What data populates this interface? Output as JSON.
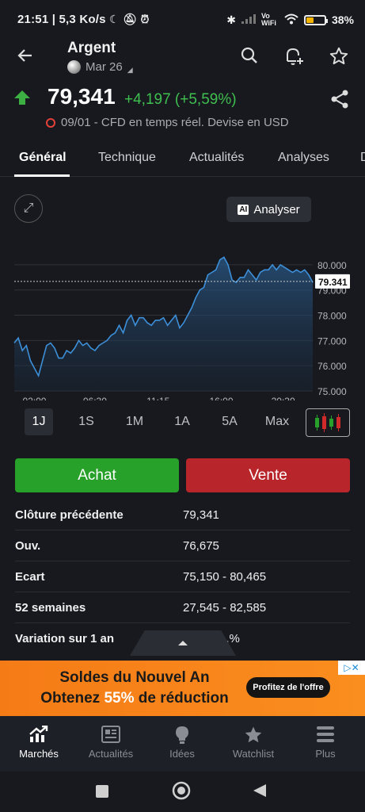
{
  "status_bar": {
    "time_speed": "21:51 | 5,3 Ko/s",
    "vowifi": "Vo WiFi",
    "battery": "38%",
    "battery_level": 0.38
  },
  "header": {
    "title": "Argent",
    "contract": "Mar 26"
  },
  "quote": {
    "price": "79,341",
    "change": "+4,197 (+5,59%)",
    "direction": "up",
    "info": "09/01 - CFD en temps réel. Devise en USD"
  },
  "tabs": [
    "Général",
    "Technique",
    "Actualités",
    "Analyses",
    "D"
  ],
  "chart": {
    "analyser_label": "Analyser",
    "ai_badge": "AI",
    "current_label": "79.341"
  },
  "chart_data": {
    "type": "area",
    "x_ticks": [
      "02:00",
      "06:30",
      "11:15",
      "16:00",
      "20:30"
    ],
    "y_ticks": [
      "80.000",
      "79.000",
      "78.000",
      "77.000",
      "76.000",
      "75.000"
    ],
    "ylim": [
      75.0,
      80.5
    ],
    "current_value": 79.341,
    "x": [
      0,
      0.3,
      0.6,
      0.9,
      1.2,
      1.5,
      1.8,
      2.1,
      2.4,
      2.7,
      3.0,
      3.3,
      3.6,
      3.9,
      4.2,
      4.5,
      4.8,
      5.1,
      5.4,
      5.7,
      6.0,
      6.3,
      6.6,
      6.9,
      7.2,
      7.5,
      7.8,
      8.1,
      8.4,
      8.7,
      9.0,
      9.3,
      9.6,
      9.9,
      10.2,
      10.5,
      10.8,
      11.1,
      11.4,
      11.7,
      12.0,
      12.3,
      12.6,
      12.9,
      13.2,
      13.5,
      13.8,
      14.1,
      14.4,
      14.7,
      15.0,
      15.3,
      15.6,
      15.9,
      16.2,
      16.5,
      16.8,
      17.1,
      17.4,
      17.7,
      18.0,
      18.3,
      18.6,
      18.9,
      19.2,
      19.5,
      19.8,
      20.1,
      20.4,
      20.7,
      21.0,
      21.3,
      21.6,
      21.9,
      22.2
    ],
    "values": [
      76.9,
      77.1,
      76.6,
      76.8,
      76.2,
      75.9,
      75.6,
      76.2,
      76.8,
      76.9,
      76.7,
      76.3,
      76.3,
      76.6,
      76.5,
      76.7,
      77.0,
      76.8,
      76.9,
      76.7,
      76.6,
      76.8,
      76.9,
      77.0,
      77.2,
      77.3,
      77.6,
      77.3,
      77.8,
      78.0,
      77.6,
      77.9,
      77.9,
      77.7,
      77.6,
      77.8,
      77.8,
      77.9,
      77.6,
      77.8,
      78.0,
      77.5,
      77.7,
      78.0,
      78.3,
      78.7,
      79.0,
      79.1,
      79.6,
      79.7,
      79.8,
      80.2,
      80.3,
      80.0,
      79.4,
      79.3,
      79.5,
      79.5,
      79.8,
      79.6,
      79.4,
      79.7,
      79.8,
      79.8,
      80.0,
      79.8,
      80.0,
      79.9,
      79.8,
      79.7,
      79.8,
      79.7,
      79.8,
      79.6,
      79.3
    ],
    "xlim": [
      0,
      22.2
    ],
    "x_tick_positions": [
      1.5,
      6.0,
      10.7,
      15.4,
      20.0
    ],
    "color": "#3c8fd8",
    "grid": true
  },
  "timeframes": {
    "items": [
      "1J",
      "1S",
      "1M",
      "1A",
      "5A",
      "Max"
    ],
    "active": "1J"
  },
  "trade": {
    "buy": "Achat",
    "sell": "Vente",
    "buy_color": "#27a12a",
    "sell_color": "#b8252a"
  },
  "stats": [
    {
      "label": "Clôture précédente",
      "value": "79,341"
    },
    {
      "label": "Ouv.",
      "value": "76,675"
    },
    {
      "label": "Ecart",
      "value": "75,150 - 80,465"
    },
    {
      "label": "52 semaines",
      "value": "27,545 - 82,585"
    },
    {
      "label": "Variation sur 1 an",
      "value": "...%"
    }
  ],
  "ad": {
    "line1": "Soldes du Nouvel An",
    "line2_pre": "Obtenez ",
    "line2_pct": "55%",
    "line2_post": " de réduction",
    "cta": "Profitez de l'offre"
  },
  "bottom_nav": [
    {
      "label": "Marchés",
      "icon": "chart-up-icon",
      "active": true
    },
    {
      "label": "Actualités",
      "icon": "news-icon",
      "active": false
    },
    {
      "label": "Idées",
      "icon": "lightbulb-icon",
      "active": false
    },
    {
      "label": "Watchlist",
      "icon": "star-icon",
      "active": false
    },
    {
      "label": "Plus",
      "icon": "menu-icon",
      "active": false
    }
  ]
}
